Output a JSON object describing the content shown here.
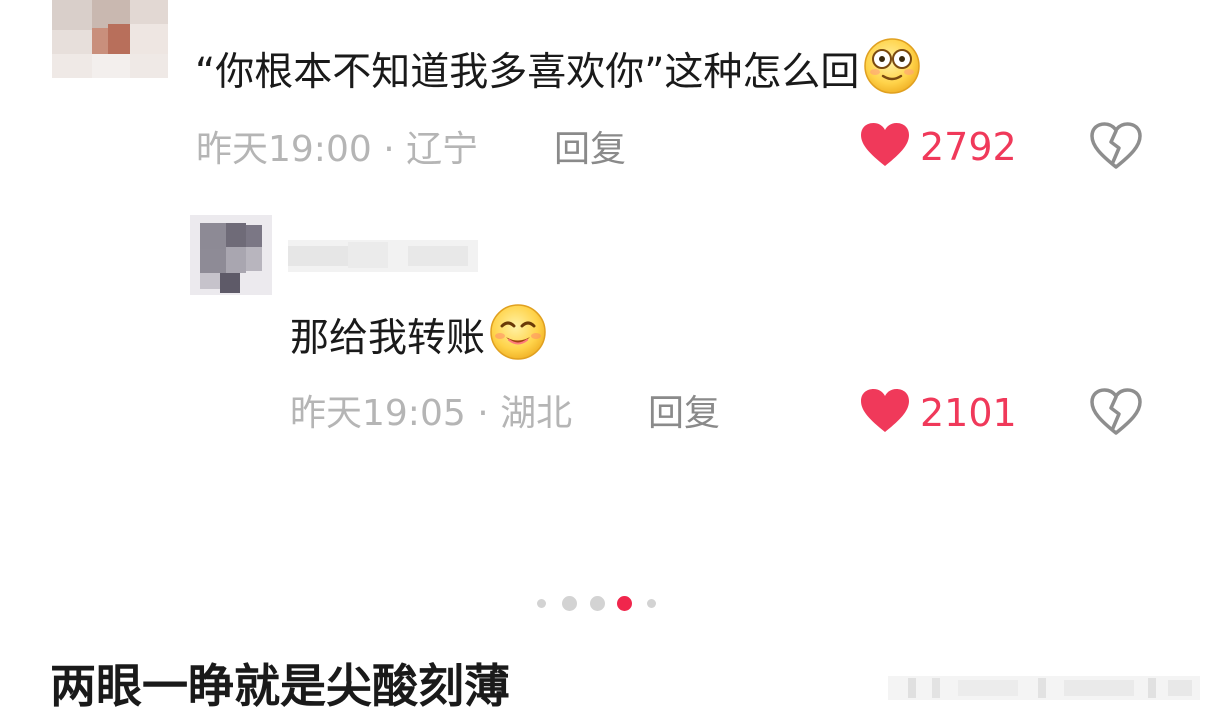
{
  "comments": [
    {
      "text": "“你根本不知道我多喜欢你”这种怎么回",
      "emoji": "dazed-emoji",
      "time_location": "昨天19:00 · 辽宁",
      "reply_label": "回复",
      "likes": "2792"
    },
    {
      "text": "那给我转账",
      "emoji": "smile-emoji",
      "time_location": "昨天19:05 · 湖北",
      "reply_label": "回复",
      "likes": "2101"
    }
  ],
  "pagination": {
    "count": 5,
    "active_index": 3
  },
  "bottom_title": "两眼一睁就是尖酸刻薄",
  "colors": {
    "like": "#f0395a",
    "active_dot": "#f0264c",
    "meta_text": "#b5b5b5",
    "reply_text": "#8a8a8a",
    "body_text": "#1a1a1a"
  },
  "icons": [
    "heart-icon",
    "broken-heart-icon"
  ]
}
